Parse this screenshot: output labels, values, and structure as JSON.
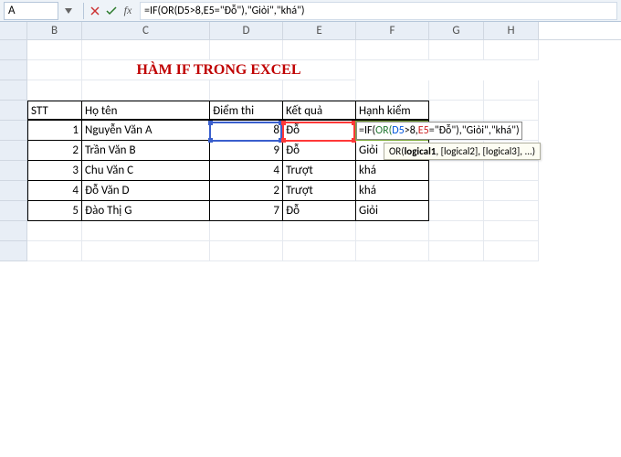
{
  "formula_bar": {
    "name_box": "A",
    "formula_text": "=IF(OR(D5>8,E5=\"Đỗ\"),\"Giỏi\",\"khá\")"
  },
  "columns": {
    "B": "B",
    "C": "C",
    "D": "D",
    "E": "E",
    "F": "F",
    "G": "G",
    "H": "H"
  },
  "title": "HÀM IF TRONG EXCEL",
  "table": {
    "headers": {
      "stt": "STT",
      "hoten": "Họ tên",
      "diemthi": "Điểm thi",
      "ketqua": "Kết quả",
      "hanhkiem": "Hạnh kiểm"
    },
    "rows": [
      {
        "stt": "1",
        "hoten": "Nguyễn Văn A",
        "diemthi": "8",
        "ketqua": "Đỗ",
        "hanhkiem": ""
      },
      {
        "stt": "2",
        "hoten": "Trần Văn B",
        "diemthi": "9",
        "ketqua": "Đỗ",
        "hanhkiem": "Giỏi"
      },
      {
        "stt": "3",
        "hoten": "Chu Văn C",
        "diemthi": "4",
        "ketqua": "Trượt",
        "hanhkiem": "khá"
      },
      {
        "stt": "4",
        "hoten": "Đỗ Văn D",
        "diemthi": "2",
        "ketqua": "Trượt",
        "hanhkiem": "khá"
      },
      {
        "stt": "5",
        "hoten": "Đào Thị G",
        "diemthi": "7",
        "ketqua": "Đỗ",
        "hanhkiem": "Giỏi"
      }
    ]
  },
  "editing_formula": {
    "prefix": "=IF(",
    "fn": "OR(",
    "arg1": "D5",
    "op1": ">8,",
    "arg2": "E5",
    "rest": "=\"Đỗ\"),\"Giỏi\",\"khá\")"
  },
  "tooltip": {
    "fn": "OR(",
    "sig": "logical1",
    "rest": ", [logical2], [logical3], ...)"
  },
  "colors": {
    "title": "#c00000",
    "range_red": "#ff3838",
    "range_blue": "#3a5fcd",
    "range_green": "#7faa3c"
  }
}
